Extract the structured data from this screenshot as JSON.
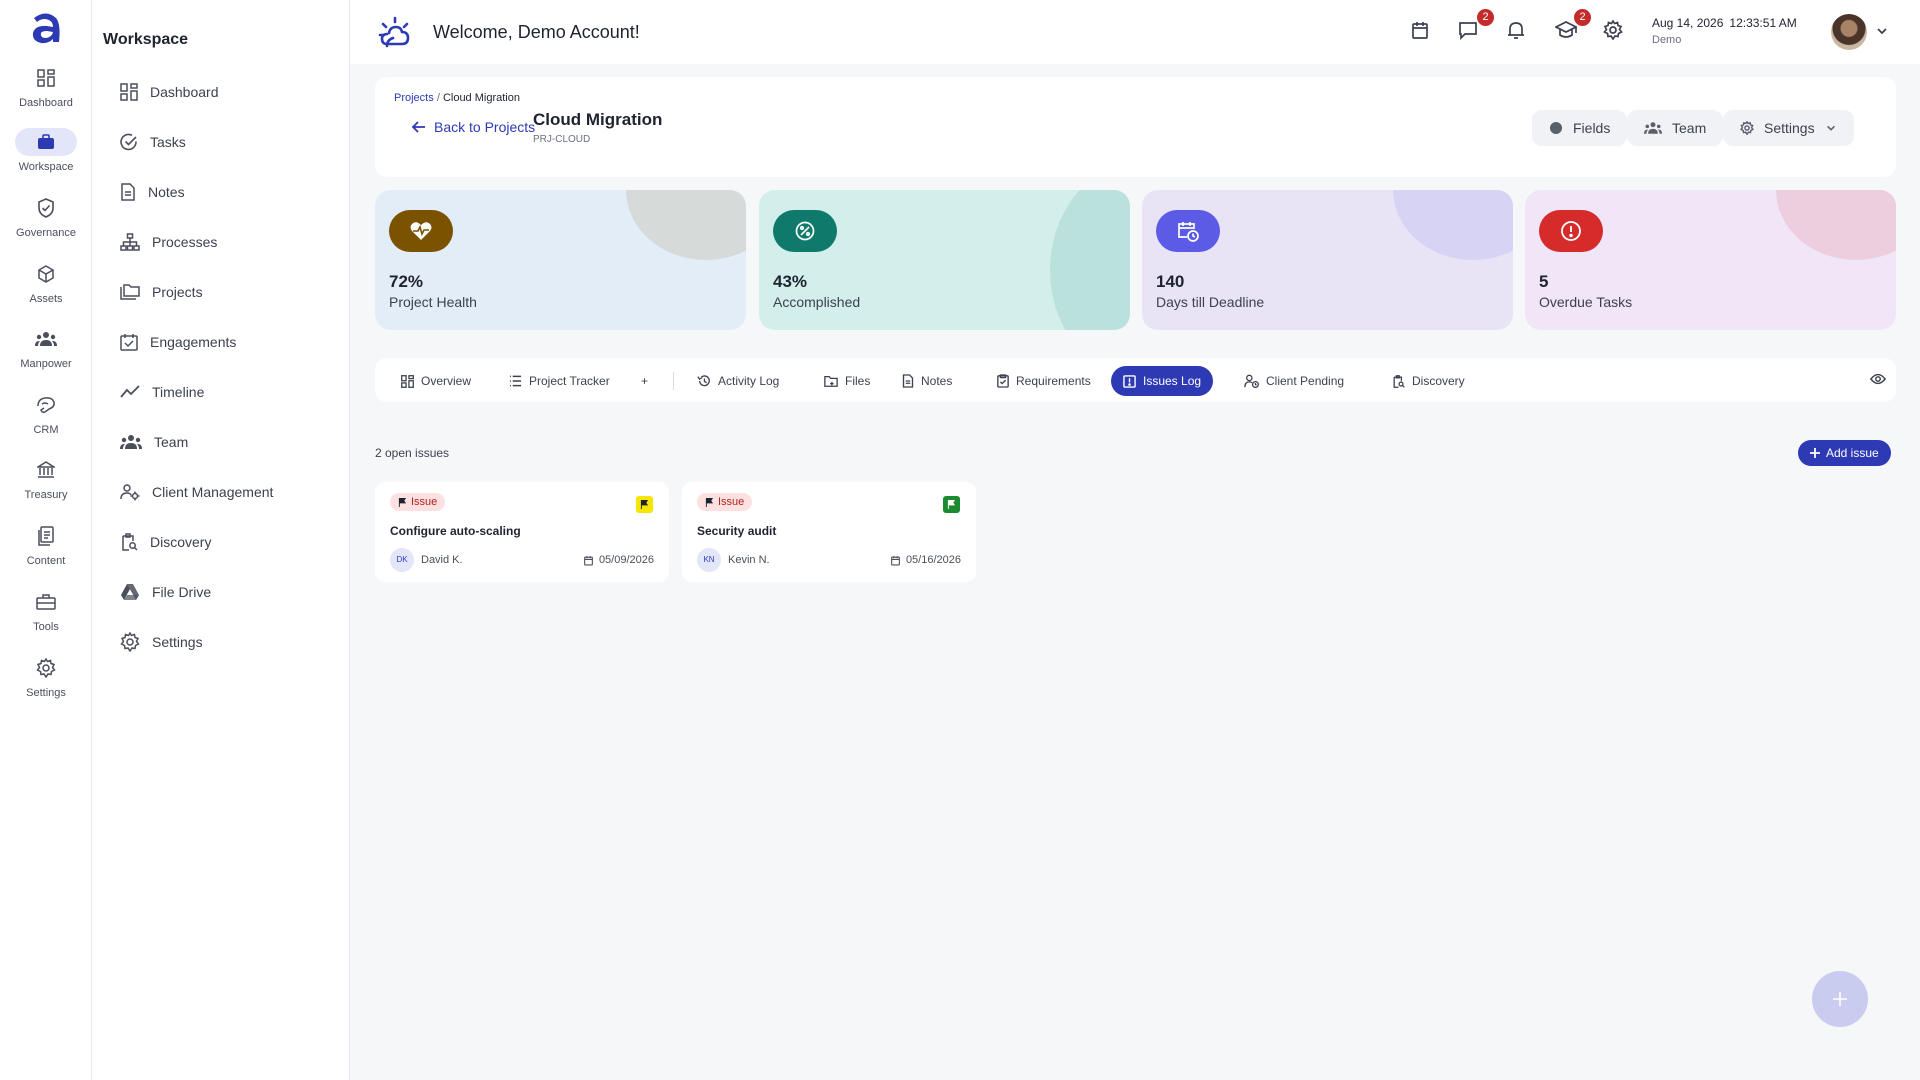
{
  "rail": {
    "items": [
      {
        "label": "Dashboard",
        "icon": "grid-icon"
      },
      {
        "label": "Workspace",
        "icon": "briefcase-icon"
      },
      {
        "label": "Governance",
        "icon": "shield-check-icon"
      },
      {
        "label": "Assets",
        "icon": "cube-icon"
      },
      {
        "label": "Manpower",
        "icon": "people-icon"
      },
      {
        "label": "CRM",
        "icon": "handshake-icon"
      },
      {
        "label": "Treasury",
        "icon": "bank-icon"
      },
      {
        "label": "Content",
        "icon": "documents-icon"
      },
      {
        "label": "Tools",
        "icon": "toolbox-icon"
      },
      {
        "label": "Settings",
        "icon": "gear-icon"
      }
    ]
  },
  "sidebar": {
    "title": "Workspace",
    "items": [
      {
        "label": "Dashboard",
        "icon": "grid-icon"
      },
      {
        "label": "Tasks",
        "icon": "check-circle-icon"
      },
      {
        "label": "Notes",
        "icon": "note-icon"
      },
      {
        "label": "Processes",
        "icon": "hierarchy-icon"
      },
      {
        "label": "Projects",
        "icon": "folders-icon"
      },
      {
        "label": "Engagements",
        "icon": "calendar-check-icon"
      },
      {
        "label": "Timeline",
        "icon": "trend-line-icon"
      },
      {
        "label": "Team",
        "icon": "people-icon"
      },
      {
        "label": "Client Management",
        "icon": "people-gear-icon"
      },
      {
        "label": "Discovery",
        "icon": "search-doc-icon"
      },
      {
        "label": "File Drive",
        "icon": "drive-icon"
      },
      {
        "label": "Settings",
        "icon": "gear-icon"
      }
    ]
  },
  "header": {
    "welcome": "Welcome, Demo Account!",
    "messages_badge": "2",
    "learning_badge": "2",
    "date": "Aug 14, 2026",
    "time": "12:33:51 AM",
    "user": "Demo"
  },
  "project": {
    "breadcrumb_parent": "Projects",
    "breadcrumb_sep": "/",
    "breadcrumb_current": "Cloud Migration",
    "back_label": "Back to Projects",
    "name": "Cloud Migration",
    "code": "PRJ-CLOUD",
    "buttons": {
      "fields": "Fields",
      "team": "Team",
      "settings": "Settings"
    }
  },
  "stats": [
    {
      "value": "72%",
      "label": "Project Health",
      "icon": "heart-pulse-icon",
      "bg": "#e3edf8",
      "accent": "#7a5200"
    },
    {
      "value": "43%",
      "label": "Accomplished",
      "icon": "percent-icon",
      "bg": "#d3efec",
      "accent": "#0f7a6c"
    },
    {
      "value": "140",
      "label": "Days till Deadline",
      "icon": "calendar-clock-icon",
      "bg": "#e8e4f6",
      "accent": "#5b5be6"
    },
    {
      "value": "5",
      "label": "Overdue Tasks",
      "icon": "alert-icon",
      "bg": "#f1e5f8",
      "accent": "#d52b2b"
    }
  ],
  "tabs": [
    {
      "label": "Overview",
      "icon": "grid-icon"
    },
    {
      "label": "Project Tracker",
      "icon": "list-icon"
    },
    {
      "label": "+",
      "icon": ""
    },
    {
      "label": "Activity Log",
      "icon": "history-icon"
    },
    {
      "label": "Files",
      "icon": "files-icon"
    },
    {
      "label": "Notes",
      "icon": "note-icon"
    },
    {
      "label": "Requirements",
      "icon": "clipboard-check-icon"
    },
    {
      "label": "Issues Log",
      "icon": "issue-icon",
      "active": true
    },
    {
      "label": "Client Pending",
      "icon": "person-clock-icon"
    },
    {
      "label": "Discovery",
      "icon": "search-doc-icon"
    }
  ],
  "issues_summary": "2 open issues",
  "add_issue_label": "Add issue",
  "issues": [
    {
      "type": "Issue",
      "title": "Configure auto-scaling",
      "initials": "DK",
      "assignee": "David K.",
      "due": "05/09/2026",
      "flag_color": "#f6e600"
    },
    {
      "type": "Issue",
      "title": "Security audit",
      "initials": "KN",
      "assignee": "Kevin N.",
      "due": "05/16/2026",
      "flag_color": "#1c8a2e"
    }
  ],
  "colors": {
    "primary": "#2e3ab4",
    "badge": "#c42b2b"
  }
}
